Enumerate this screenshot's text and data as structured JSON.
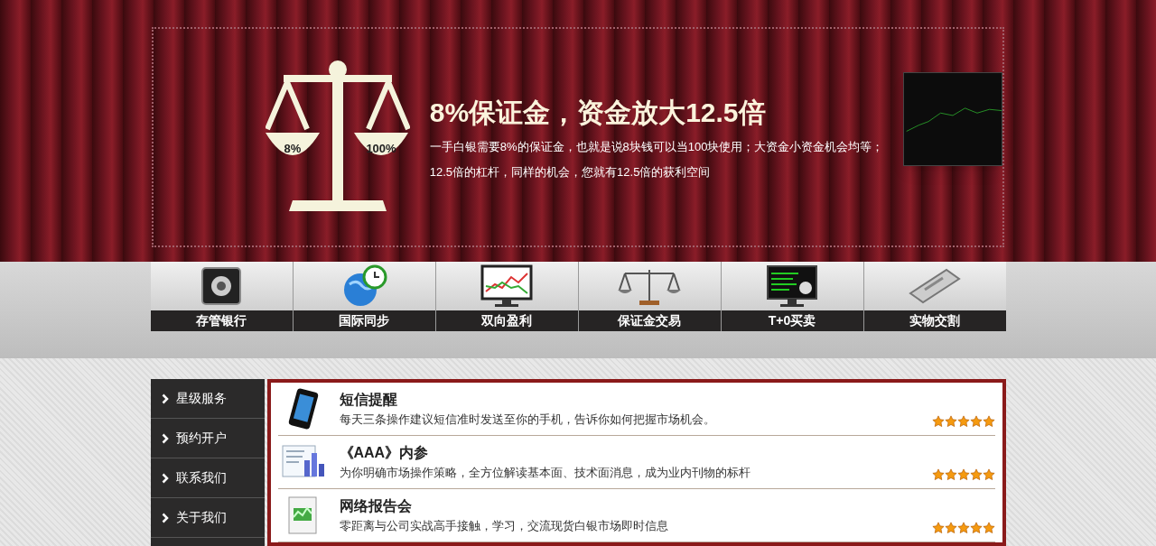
{
  "banner": {
    "title": "8%保证金，资金放大12.5倍",
    "lines": [
      "一手白银需要8%的保证金，也就是说8块钱可以当100块使用；大资金小资金机会均等；",
      "12.5倍的杠杆，同样的机会，您就有12.5倍的获利空间"
    ],
    "scale_labels": [
      "8%",
      "100%"
    ]
  },
  "features": [
    {
      "kind": "safe",
      "label": "存管银行"
    },
    {
      "kind": "globe",
      "label": "国际同步"
    },
    {
      "kind": "chart",
      "label": "双向盈利"
    },
    {
      "kind": "scale",
      "label": "保证金交易"
    },
    {
      "kind": "gear",
      "label": "T+0买卖"
    },
    {
      "kind": "bar",
      "label": "实物交割"
    }
  ],
  "sidebar": {
    "items": [
      "星级服务",
      "预约开户",
      "联系我们",
      "关于我们"
    ]
  },
  "services": [
    {
      "kind": "phone",
      "title": "短信提醒",
      "description": "每天三条操作建议短信准时发送至你的手机，告诉你如何把握市场机会。",
      "stars": 5
    },
    {
      "kind": "report",
      "title": "《AAA》内参",
      "description": "为你明确市场操作策略，全方位解读基本面、技术面消息，成为业内刊物的标杆",
      "stars": 5
    },
    {
      "kind": "doc",
      "title": "网络报告会",
      "description": "零距离与公司实战高手接触，学习，交流现货白银市场即时信息",
      "stars": 5
    }
  ]
}
